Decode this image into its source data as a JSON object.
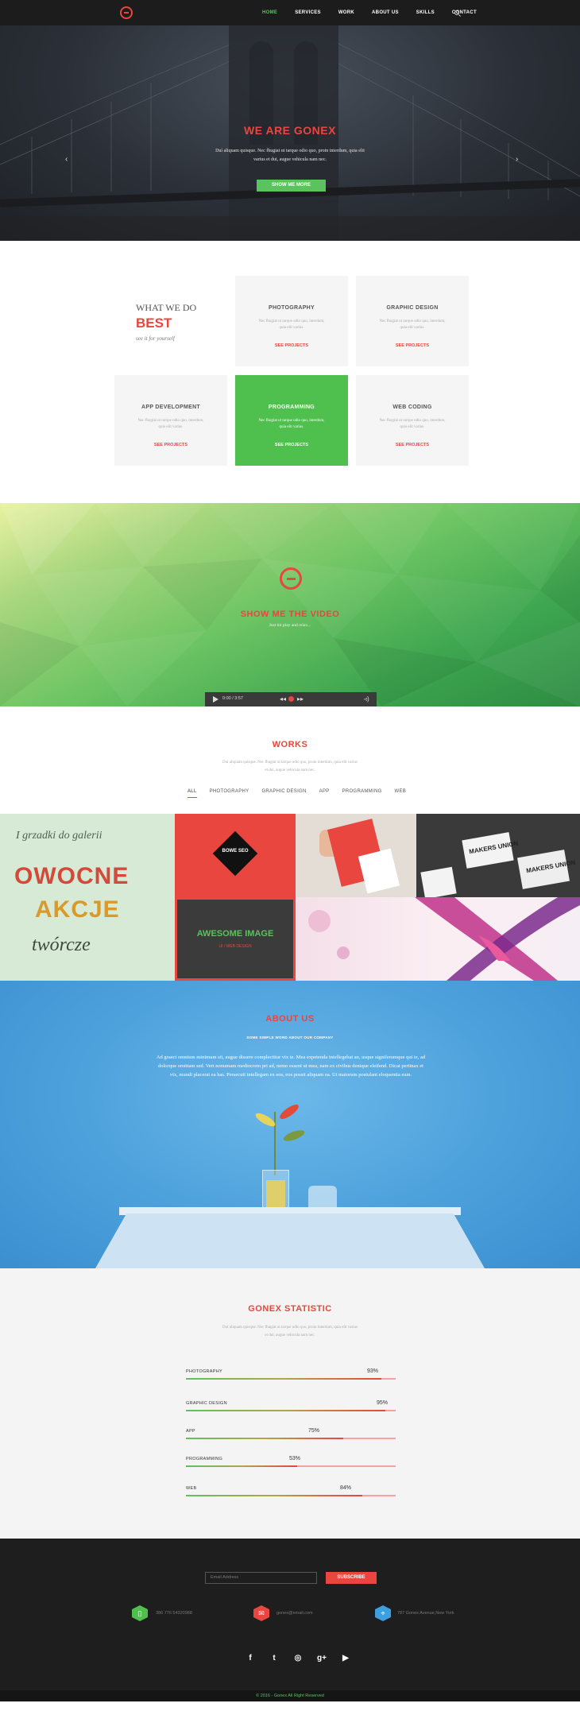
{
  "nav": {
    "items": [
      "HOME",
      "SERVICES",
      "WORK",
      "ABOUT US",
      "SKILLS",
      "CONTACT"
    ],
    "active": "HOME"
  },
  "hero": {
    "title": "WE ARE GONEX",
    "text": "Duí aliquam quisque. Nec fhugiat ut tarque odio quo, proin interdum, quia elit varius et dui, augue vehicula nam nec.",
    "button": "SHOW ME MORE",
    "prev_arrow": "‹",
    "next_arrow": "›"
  },
  "services": {
    "heading_line1": "WHAT WE DO",
    "heading_line2": "BEST",
    "heading_line3": "see it for yourself",
    "cards": [
      {
        "title": "PHOTOGRAPHY",
        "desc": "Nec fhugiat ut tarque odio quo, interdum, quia elit varius.",
        "link": "SEE PROJECTS"
      },
      {
        "title": "GRAPHIC DESIGN",
        "desc": "Nec fhugiat ut tarque odio quo, interdum, quia elit varius.",
        "link": "SEE PROJECTS"
      },
      {
        "title": "APP DEVELOPMENT",
        "desc": "Nec fhugiat ut tarque odio quo, interdum, quia elit varius.",
        "link": "SEE PROJECTS"
      },
      {
        "title": "PROGRAMMING",
        "desc": "Nec fhugiat ut tarque odio quo, interdum, quia elit varius.",
        "link": "SEE PROJECTS"
      },
      {
        "title": "WEB CODING",
        "desc": "Nec fhugiat ut tarque odio quo, interdum, quia elit varius.",
        "link": "SEE PROJECTS"
      }
    ]
  },
  "video": {
    "title": "SHOW ME THE VIDEO",
    "subtitle": "Just hit play and relax...",
    "time": "0:00 / 3:57"
  },
  "works": {
    "title": "WORKS",
    "desc": "Duí aliquam quisque. Nec fhugiat ut tarque odio quo, proin interdum, quia elit varius et dui, augue vehicula nam nec.",
    "filters": [
      "ALL",
      "PHOTOGRAPHY",
      "GRAPHIC DESIGN",
      "APP",
      "PROGRAMMING",
      "WEB"
    ],
    "overlay_title": "AWESOME IMAGE",
    "overlay_sub": "UI / WEB DESIGN",
    "tile1_line1": "I grzadki do galerii",
    "tile1_line2": "OWOCNE",
    "tile1_line3": "AKCJE",
    "tile1_line4": "twórcze",
    "tile2_text": "BOWE SEO",
    "tile4_text1": "MAKERS UNION",
    "tile4_text2": "MAKERS UNION"
  },
  "about": {
    "title": "ABOUT US",
    "subtitle": "SOME SIMPLE WORD ABOUT OUR COMPANY",
    "text": "Ad graeci omnium minimum sit, augue dissere complectitur vix te. Mea expetenda intellegebat an, usque signiferumque qui te, ad dolorque omittam sed. Vert nonumam mediocrem pri ad, nemo essent ut mea, nam ex civibus denique eleifend. Dicat pertinax et vix, mundi placerat ea has. Persecuti intellegam ex eos, eos possit aliquam ea. Ut maiorum postulant eloquentia eum."
  },
  "stats": {
    "title": "GONEX STATISTIC",
    "desc": "Duí aliquam quisque. Nec fhugiat ut tarque odio quo, proin interdum, quia elit varius et dui, augue vehicula nam nec.",
    "items": [
      {
        "label": "PHOTOGRAPHY",
        "pct_text": "93%",
        "value": 0.93
      },
      {
        "label": "GRAPHIC DESIGN",
        "pct_text": "95%",
        "value": 0.95
      },
      {
        "label": "APP",
        "pct_text": "75%",
        "value": 0.75
      },
      {
        "label": "PROGRAMMING",
        "pct_text": "53%",
        "value": 0.53
      },
      {
        "label": "WEB",
        "pct_text": "84%",
        "value": 0.84
      }
    ]
  },
  "footer": {
    "email_placeholder": "Email Address",
    "subscribe": "SUBSCRIBE",
    "phone": "386 776 54320988",
    "email": "gonex@email.com",
    "address": "787 Gonex Avenue,New York",
    "phone_icon": "phone-icon",
    "mail_icon": "mail-icon",
    "location_icon": "location-icon",
    "socials": [
      "f",
      "t",
      "◎",
      "g+",
      "▶"
    ],
    "copyright": "© 2016 - Gonex All Right Reserved"
  },
  "colors": {
    "accent_red": "#e8463f",
    "accent_green": "#5ac35d",
    "dark": "#1e1e1e"
  }
}
